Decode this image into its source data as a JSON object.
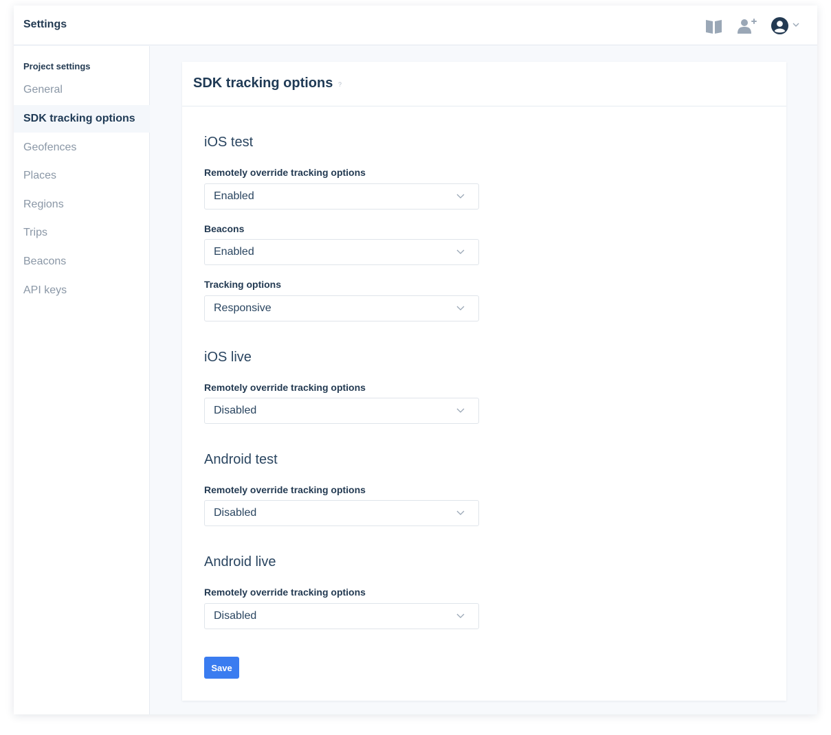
{
  "header": {
    "title": "Settings",
    "icons": [
      "book-icon",
      "add-user-icon",
      "account-icon",
      "chevron-down-icon"
    ]
  },
  "sidebar": {
    "section_title": "Project settings",
    "items": [
      {
        "label": "General",
        "active": false
      },
      {
        "label": "SDK tracking options",
        "active": true
      },
      {
        "label": "Geofences",
        "active": false
      },
      {
        "label": "Places",
        "active": false
      },
      {
        "label": "Regions",
        "active": false
      },
      {
        "label": "Trips",
        "active": false
      },
      {
        "label": "Beacons",
        "active": false
      },
      {
        "label": "API keys",
        "active": false
      }
    ]
  },
  "main": {
    "title": "SDK tracking options",
    "help_mark": "?",
    "sections": [
      {
        "title": "iOS test",
        "fields": [
          {
            "label": "Remotely override tracking options",
            "value": "Enabled"
          },
          {
            "label": "Beacons",
            "value": "Enabled"
          },
          {
            "label": "Tracking options",
            "value": "Responsive"
          }
        ]
      },
      {
        "title": "iOS live",
        "fields": [
          {
            "label": "Remotely override tracking options",
            "value": "Disabled"
          }
        ]
      },
      {
        "title": "Android test",
        "fields": [
          {
            "label": "Remotely override tracking options",
            "value": "Disabled"
          }
        ]
      },
      {
        "title": "Android live",
        "fields": [
          {
            "label": "Remotely override tracking options",
            "value": "Disabled"
          }
        ]
      }
    ],
    "save_label": "Save"
  },
  "colors": {
    "accent": "#3a7cf0",
    "text_primary": "#1f3a55",
    "text_muted": "#8a97a6",
    "background": "#f7f9fc",
    "icon": "#9aa7b6"
  }
}
